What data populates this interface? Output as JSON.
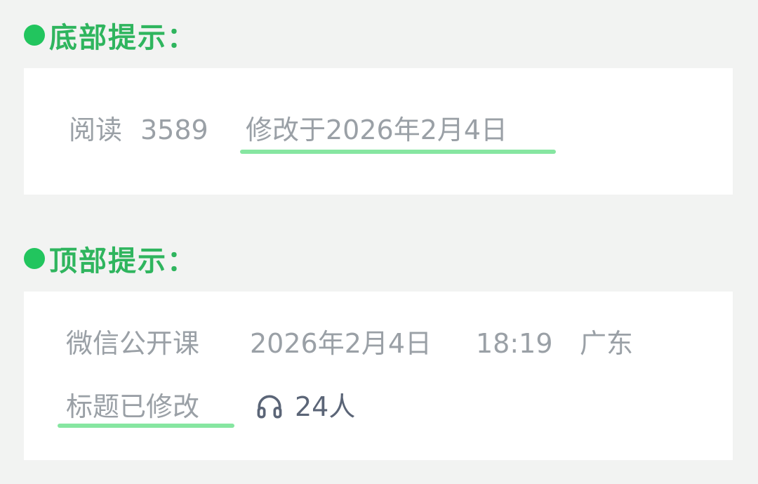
{
  "sections": {
    "bottom": {
      "heading": "底部提示：",
      "read_label": "阅读",
      "read_count": "3589",
      "modified_text": "修改于2026年2月4日"
    },
    "top": {
      "heading": "顶部提示：",
      "account_name": "微信公开课",
      "date": "2026年2月4日",
      "time": "18:19",
      "location": "广东",
      "title_modified": "标题已修改",
      "listeners": "24人",
      "listen_icon": "headphones-icon"
    }
  },
  "colors": {
    "accent_green": "#22c55e",
    "heading_green": "#2fb55e",
    "underline_green": "#86e6a1",
    "meta_gray": "#9aa0a6",
    "background": "#f2f3f2"
  }
}
